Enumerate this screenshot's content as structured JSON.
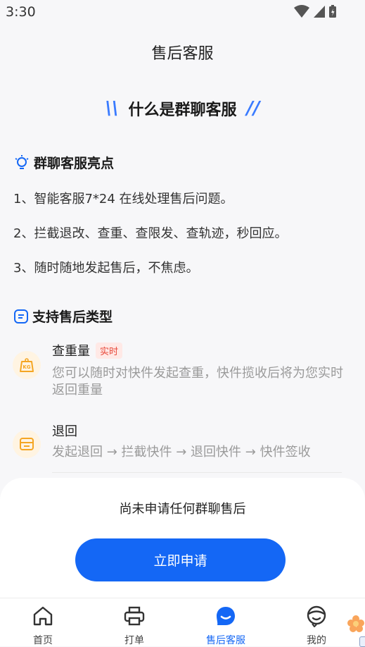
{
  "status_bar": {
    "time": "3:30"
  },
  "page": {
    "title": "售后客服"
  },
  "intro": {
    "heading": "什么是群聊客服"
  },
  "highlights": {
    "title": "群聊客服亮点",
    "items": [
      "1、智能客服7*24 在线处理售后问题。",
      "2、拦截退改、查重、查限发、查轨迹，秒回应。",
      "3、随时随地发起售后，不焦虑。"
    ]
  },
  "types": {
    "title": "支持售后类型",
    "items": [
      {
        "title": "查重量",
        "badge": "实时",
        "desc": "您可以随时对快件发起查重，快件揽收后将为您实时返回重量",
        "icon": "kg-scale-icon"
      },
      {
        "title": "退回",
        "desc": "发起退回 → 拦截快件 → 退回快件 → 快件签收",
        "icon": "return-box-icon"
      }
    ]
  },
  "sheet": {
    "empty_text": "尚未申请任何群聊售后",
    "apply_label": "立即申请"
  },
  "tabbar": {
    "tabs": [
      {
        "label": "首页",
        "icon": "home-icon"
      },
      {
        "label": "打单",
        "icon": "printer-icon"
      },
      {
        "label": "售后客服",
        "icon": "service-chat-icon",
        "active": true
      },
      {
        "label": "我的",
        "icon": "profile-icon"
      }
    ]
  },
  "colors": {
    "accent": "#1467f5",
    "badge_text": "#e8493b",
    "icon_orange": "#f5a623"
  }
}
